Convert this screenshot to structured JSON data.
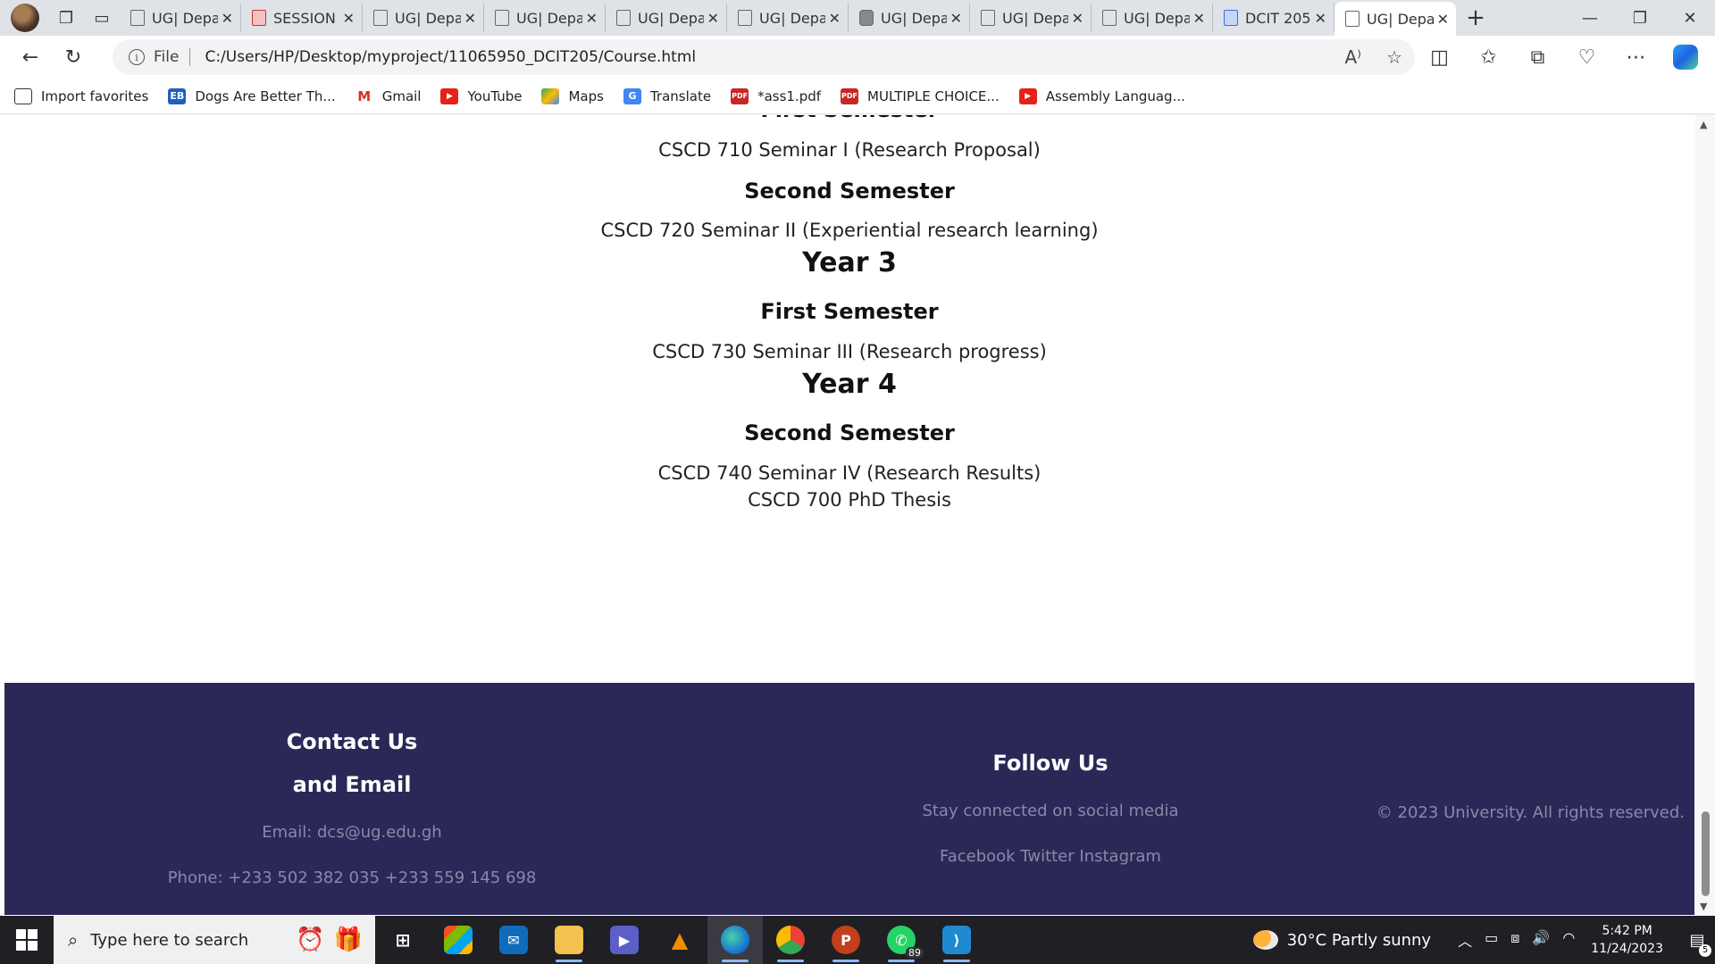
{
  "browser": {
    "tabs": [
      {
        "title": "UG| Department",
        "icon": "page"
      },
      {
        "title": "SESSION",
        "icon": "pdf"
      },
      {
        "title": "UG| Department",
        "icon": "page"
      },
      {
        "title": "UG| Department",
        "icon": "page"
      },
      {
        "title": "UG| Department",
        "icon": "page"
      },
      {
        "title": "UG| Department",
        "icon": "page"
      },
      {
        "title": "UG| Department",
        "icon": "cube"
      },
      {
        "title": "UG| Department",
        "icon": "page"
      },
      {
        "title": "UG| Department",
        "icon": "page"
      },
      {
        "title": "DCIT 205",
        "icon": "doc"
      },
      {
        "title": "UG| Department",
        "icon": "page",
        "active": true
      }
    ],
    "address": {
      "scheme_label": "File",
      "url": "C:/Users/HP/Desktop/myproject/11065950_DCIT205/Course.html"
    },
    "favorites": [
      {
        "label": "Import favorites",
        "icon": "import-icon"
      },
      {
        "label": "Dogs Are Better Th...",
        "icon": "eb-icon"
      },
      {
        "label": "Gmail",
        "icon": "gmail-icon"
      },
      {
        "label": "YouTube",
        "icon": "youtube-icon"
      },
      {
        "label": "Maps",
        "icon": "maps-icon"
      },
      {
        "label": "Translate",
        "icon": "translate-icon"
      },
      {
        "label": "*ass1.pdf",
        "icon": "pdf-icon"
      },
      {
        "label": "MULTIPLE CHOICE...",
        "icon": "pdf-icon"
      },
      {
        "label": "Assembly Languag...",
        "icon": "youtube-icon"
      }
    ]
  },
  "page": {
    "partial_heading": "First Semester",
    "year2_sem1_course": "CSCD 710 Seminar I (Research Proposal)",
    "year2_sem2_heading": "Second Semester",
    "year2_sem2_course": "CSCD 720 Seminar II (Experiential research learning)",
    "year3_heading": "Year 3",
    "year3_sem1_heading": "First Semester",
    "year3_sem1_course": "CSCD 730 Seminar III (Research progress)",
    "year4_heading": "Year 4",
    "year4_sem2_heading": "Second Semester",
    "year4_sem2_course1": "CSCD 740 Seminar IV (Research Results)",
    "year4_sem2_course2": "CSCD 700 PhD Thesis"
  },
  "footer": {
    "contact_title_line1": "Contact Us",
    "contact_title_line2": "and Email",
    "email": "Email: dcs@ug.edu.gh",
    "phone": "Phone: +233 502 382 035 +233 559 145 698",
    "follow_title": "Follow Us",
    "follow_text": "Stay connected on social media",
    "social_links": "Facebook Twitter Instagram",
    "copyright": "© 2023 University. All rights reserved."
  },
  "taskbar": {
    "search_placeholder": "Type here to search",
    "whatsapp_badge": "89",
    "weather": "30°C  Partly sunny",
    "time": "5:42 PM",
    "date": "11/24/2023",
    "notification_count": "5"
  },
  "colors": {
    "footer_bg": "#2b2857",
    "footer_muted_text": "#8a88a8",
    "taskbar_bg": "#1f1f24"
  }
}
